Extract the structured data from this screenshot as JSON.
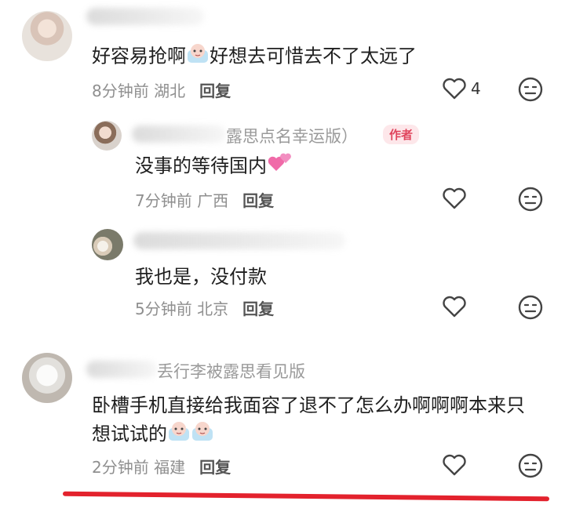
{
  "comments": [
    {
      "text": "好容易抢啊",
      "text_tail": "好想去可惜去不了太远了",
      "time": "8分钟前",
      "location": "湖北",
      "reply": "回复",
      "likes": "4"
    },
    {
      "name_visible": "露思点名幸运版）",
      "badge": "作者",
      "text": "没事的等待国内",
      "time": "7分钟前",
      "location": "广西",
      "reply": "回复"
    },
    {
      "text": "我也是，没付款",
      "time": "5分钟前",
      "location": "北京",
      "reply": "回复"
    },
    {
      "name_visible": "丢行李被露思看见版",
      "text_line1": "卧槽手机直接给我面容了退不了怎么办啊啊啊本来只",
      "text_line2": "想试试的",
      "time": "2分钟前",
      "location": "福建",
      "reply": "回复"
    }
  ],
  "colors": {
    "accent_line": "#e3222d",
    "author_badge": "#e0455d",
    "heart": "#444444"
  }
}
